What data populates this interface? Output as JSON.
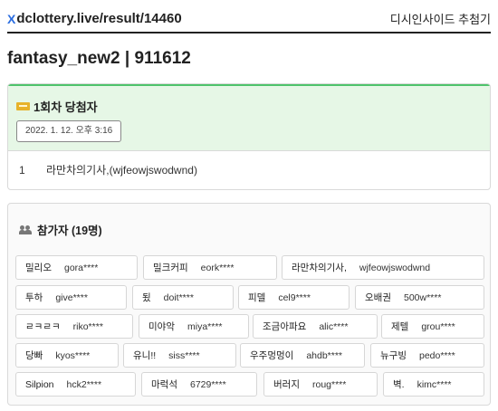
{
  "header": {
    "brand_icon": "X",
    "url_text": "dclottery.live/result/14460",
    "site_name": "디시인사이드 추첨기"
  },
  "page_title": "fantasy_new2 | 911612",
  "winner_section": {
    "icon": "ticket-icon",
    "title": "1회차 당첨자",
    "date": "2022. 1. 12. 오후 3:16",
    "winners": [
      {
        "rank": "1",
        "name": "라만차의기사,(wjfeowjswodwnd)"
      }
    ]
  },
  "participants": {
    "icon": "users-icon",
    "title": "참가자 (19명)",
    "list": [
      {
        "nick": "밀리오",
        "id": "gora****"
      },
      {
        "nick": "밀크커피",
        "id": "eork****"
      },
      {
        "nick": "라만차의기사,",
        "id": "wjfeowjswodwnd"
      },
      {
        "nick": "투하",
        "id": "give****"
      },
      {
        "nick": "됬",
        "id": "doit****"
      },
      {
        "nick": "피델",
        "id": "cel9****"
      },
      {
        "nick": "오배권",
        "id": "500w****"
      },
      {
        "nick": "ㄹㅋㄹㅋ",
        "id": "riko****"
      },
      {
        "nick": "미야악",
        "id": "miya****"
      },
      {
        "nick": "조금아파요",
        "id": "alic****"
      },
      {
        "nick": "제텔",
        "id": "grou****"
      },
      {
        "nick": "당빠",
        "id": "kyos****"
      },
      {
        "nick": "유니!!",
        "id": "siss****"
      },
      {
        "nick": "우주멍멍이",
        "id": "ahdb****"
      },
      {
        "nick": "뉴구빙",
        "id": "pedo****"
      },
      {
        "nick": "Silpion",
        "id": "hck2****"
      },
      {
        "nick": "마럭석",
        "id": "6729****"
      },
      {
        "nick": "버러지",
        "id": "roug****"
      },
      {
        "nick": "벽.",
        "id": "kimc****"
      }
    ]
  },
  "colors": {
    "winner_bg": "#e6f7e6",
    "winner_accent": "#4ec36b",
    "brand_icon": "#2b6de0"
  }
}
